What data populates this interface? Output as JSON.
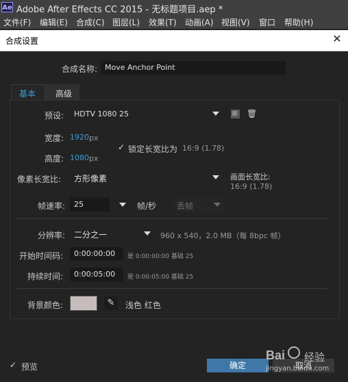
{
  "app": {
    "logo_text": "Ae",
    "title": "Adobe After Effects CC 2015 - 无标题项目.aep *"
  },
  "menu": [
    "文件(F)",
    "编辑(E)",
    "合成(C)",
    "图层(L)",
    "效果(T)",
    "动画(A)",
    "视图(V)",
    "窗口",
    "帮助(H)"
  ],
  "dialog": {
    "title": "合成设置",
    "close": "✕",
    "comp_name_label": "合成名称:",
    "comp_name_value": "Move Anchor Point",
    "tabs": [
      "基本",
      "高级"
    ],
    "preset_label": "预设:",
    "preset_value": "HDTV 1080 25",
    "width_label": "宽度:",
    "width_value": "1920",
    "width_unit": "px",
    "height_label": "高度:",
    "height_value": "1080",
    "height_unit": "px",
    "lock_ratio_label": "锁定长宽比为",
    "lock_ratio_value": "16:9 (1.78)",
    "pixel_aspect_label": "像素长宽比:",
    "pixel_aspect_value": "方形像素",
    "frame_aspect_label": "画面长宽比:",
    "frame_aspect_value": "16:9 (1.78)",
    "frame_rate_label": "帧速率:",
    "frame_rate_value": "25",
    "frame_rate_unit": "帧/秒",
    "drop_frame_value": "丢帧",
    "resolution_label": "分辨率:",
    "resolution_value": "二分之一",
    "resolution_info": "960 x 540，2.0 MB（每 8bpc 帧）",
    "start_tc_label": "开始时间码:",
    "start_tc_value": "0:00:00:00",
    "start_tc_info": "是 0:00:00:00  基础 25",
    "duration_label": "持续时间:",
    "duration_value": "0:00:05:00",
    "duration_info": "是 0:00:05:00  基础 25",
    "bg_color_label": "背景颜色:",
    "bg_color_name": "浅色 红色",
    "bg_color": "#c7bcbc",
    "preview_label": "预览",
    "ok_label": "确定",
    "cancel_label": "取消"
  },
  "watermark": {
    "logo": "Bai",
    "text": "经验",
    "url": "jingyan.baidu.com"
  }
}
